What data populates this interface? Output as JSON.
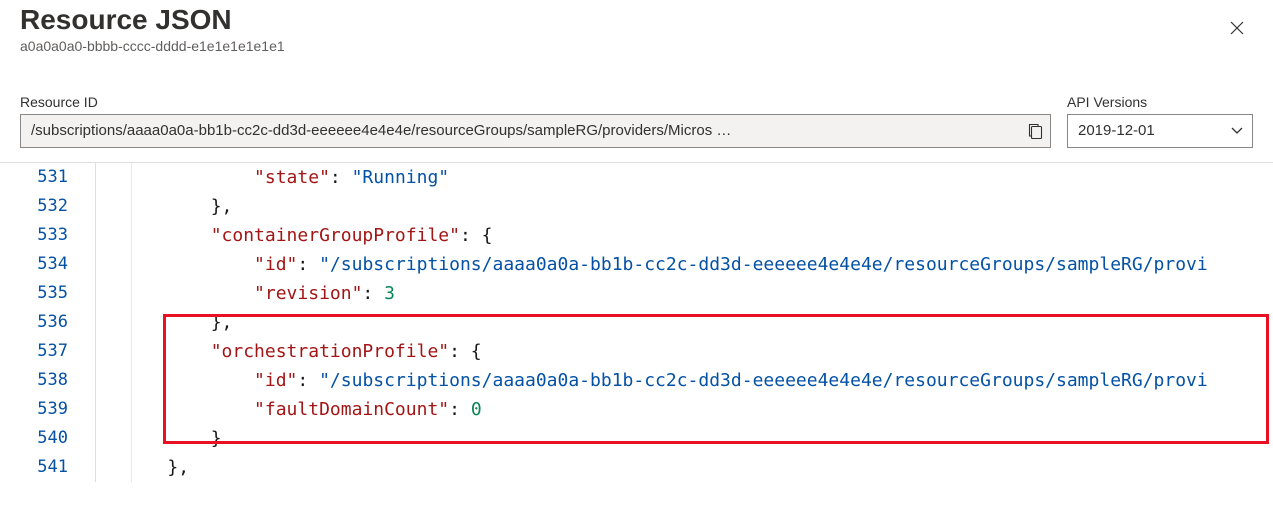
{
  "header": {
    "title": "Resource JSON",
    "subtitle": "a0a0a0a0-bbbb-cccc-dddd-e1e1e1e1e1e1"
  },
  "form": {
    "resourceIdLabel": "Resource ID",
    "resourceIdValue": "/subscriptions/aaaa0a0a-bb1b-cc2c-dd3d-eeeeee4e4e4e/resourceGroups/sampleRG/providers/Micros …",
    "apiVersionsLabel": "API Versions",
    "apiVersionValue": "2019-12-01"
  },
  "code": {
    "lines": [
      {
        "num": "531",
        "indent": "            ",
        "parts": [
          {
            "t": "key",
            "v": "\"state\""
          },
          {
            "t": "p",
            "v": ": "
          },
          {
            "t": "str",
            "v": "\"Running\""
          }
        ]
      },
      {
        "num": "532",
        "indent": "        ",
        "parts": [
          {
            "t": "p",
            "v": "},"
          }
        ]
      },
      {
        "num": "533",
        "indent": "        ",
        "parts": [
          {
            "t": "key",
            "v": "\"containerGroupProfile\""
          },
          {
            "t": "p",
            "v": ": {"
          }
        ]
      },
      {
        "num": "534",
        "indent": "            ",
        "parts": [
          {
            "t": "key",
            "v": "\"id\""
          },
          {
            "t": "p",
            "v": ": "
          },
          {
            "t": "str",
            "v": "\"/subscriptions/aaaa0a0a-bb1b-cc2c-dd3d-eeeeee4e4e4e/resourceGroups/sampleRG/provi"
          }
        ]
      },
      {
        "num": "535",
        "indent": "            ",
        "parts": [
          {
            "t": "key",
            "v": "\"revision\""
          },
          {
            "t": "p",
            "v": ": "
          },
          {
            "t": "num",
            "v": "3"
          }
        ]
      },
      {
        "num": "536",
        "indent": "        ",
        "parts": [
          {
            "t": "p",
            "v": "},"
          }
        ]
      },
      {
        "num": "537",
        "indent": "        ",
        "parts": [
          {
            "t": "key",
            "v": "\"orchestrationProfile\""
          },
          {
            "t": "p",
            "v": ": {"
          }
        ]
      },
      {
        "num": "538",
        "indent": "            ",
        "parts": [
          {
            "t": "key",
            "v": "\"id\""
          },
          {
            "t": "p",
            "v": ": "
          },
          {
            "t": "str",
            "v": "\"/subscriptions/aaaa0a0a-bb1b-cc2c-dd3d-eeeeee4e4e4e/resourceGroups/sampleRG/provi"
          }
        ]
      },
      {
        "num": "539",
        "indent": "            ",
        "parts": [
          {
            "t": "key",
            "v": "\"faultDomainCount\""
          },
          {
            "t": "p",
            "v": ": "
          },
          {
            "t": "num",
            "v": "0"
          }
        ]
      },
      {
        "num": "540",
        "indent": "        ",
        "parts": [
          {
            "t": "p",
            "v": "}"
          }
        ]
      },
      {
        "num": "541",
        "indent": "    ",
        "parts": [
          {
            "t": "p",
            "v": "},"
          }
        ]
      }
    ]
  }
}
